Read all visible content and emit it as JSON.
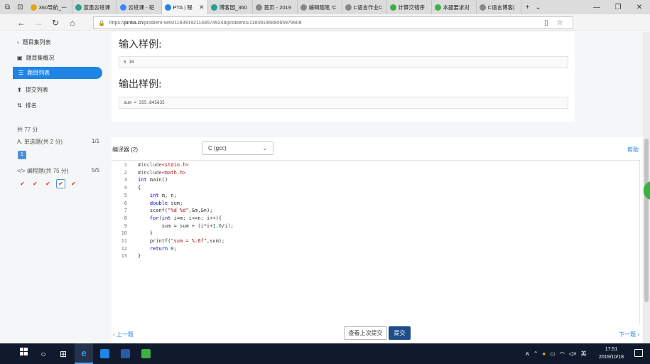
{
  "browser": {
    "tabs": [
      {
        "label": "360导航_一",
        "color": "#e8a317"
      },
      {
        "label": "蓝墨云班课",
        "color": "#2a9d8f"
      },
      {
        "label": "云班课 - 班",
        "color": "#3a86ff"
      },
      {
        "label": "PTA | 程",
        "color": "#1e84e6",
        "active": true
      },
      {
        "label": "博客园_360",
        "color": "#2a9d8f"
      },
      {
        "label": "首页 - 2019",
        "color": "#888888"
      },
      {
        "label": "编辑随笔 'C",
        "color": "#888888"
      },
      {
        "label": "C语言作业C",
        "color": "#888888"
      },
      {
        "label": "计算交错序",
        "color": "#3cb043"
      },
      {
        "label": "本题要求对",
        "color": "#3cb043"
      },
      {
        "label": "C语言博客(",
        "color": "#888888"
      }
    ],
    "url_prefix": "https://",
    "url_host": "pintia.cn",
    "url_path": "/problem-sets/1183919211485749248/problems/1183919689065979908"
  },
  "sidebar": {
    "back": "题目集列表",
    "overview": "题目集概况",
    "problem_list": "题目列表",
    "submissions": "提交列表",
    "ranking": "排名",
    "total": "共 77 分",
    "single_choice": "单选题(共 2 分)",
    "single_choice_score": "1/1",
    "single_q": "1",
    "programming": "编程题(共 75 分)",
    "programming_score": "5/5",
    "checks": [
      "✔",
      "✔",
      "✔",
      "✔",
      "✔"
    ]
  },
  "problem": {
    "input_heading": "输入样例:",
    "input_sample": "5 10",
    "output_heading": "输出样例:",
    "output_sample": "sum = 355.845635"
  },
  "editor": {
    "compiler_label": "编译器 (2)",
    "compiler_value": "C (gcc)",
    "help": "帮助",
    "line_numbers": [
      "1",
      "2",
      "3",
      "4",
      "5",
      "6",
      "7",
      "8",
      "9",
      "10",
      "11",
      "12",
      "13"
    ]
  },
  "footer": {
    "prev": "上一题",
    "next": "下一题",
    "view_last": "查看上次提交",
    "submit": "提交"
  },
  "taskbar": {
    "time": "17:51",
    "date": "2019/10/18",
    "ime": "英"
  }
}
